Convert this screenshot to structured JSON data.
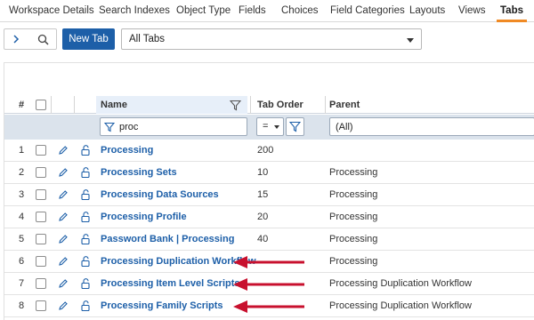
{
  "tabs": [
    {
      "label": "Workspace Details",
      "active": false
    },
    {
      "label": "Search Indexes",
      "active": false
    },
    {
      "label": "Object Type",
      "active": false
    },
    {
      "label": "Fields",
      "active": false
    },
    {
      "label": "Choices",
      "active": false
    },
    {
      "label": "Field Categories",
      "active": false
    },
    {
      "label": "Layouts",
      "active": false
    },
    {
      "label": "Views",
      "active": false
    },
    {
      "label": "Tabs",
      "active": true
    }
  ],
  "toolbar": {
    "new_tab_label": "New Tab",
    "view_select_value": "All Tabs",
    "icons": [
      "chevron-right-icon",
      "search-icon"
    ]
  },
  "grid": {
    "columns": {
      "number": "#",
      "name": "Name",
      "tab_order": "Tab Order",
      "parent": "Parent"
    },
    "filters": {
      "name": "proc",
      "tab_order_operator": "=",
      "parent": "(All)"
    },
    "rows": [
      {
        "number": "1",
        "name": "Processing",
        "tab_order": "200",
        "parent": ""
      },
      {
        "number": "2",
        "name": "Processing Sets",
        "tab_order": "10",
        "parent": "Processing"
      },
      {
        "number": "3",
        "name": "Processing Data Sources",
        "tab_order": "15",
        "parent": "Processing"
      },
      {
        "number": "4",
        "name": "Processing Profile",
        "tab_order": "20",
        "parent": "Processing"
      },
      {
        "number": "5",
        "name": "Password Bank | Processing",
        "tab_order": "40",
        "parent": "Processing"
      },
      {
        "number": "6",
        "name": "Processing Duplication Workflow",
        "tab_order": "",
        "parent": "Processing"
      },
      {
        "number": "7",
        "name": "Processing Item Level Scripts",
        "tab_order": "",
        "parent": "Processing Duplication Workflow"
      },
      {
        "number": "8",
        "name": "Processing Family Scripts",
        "tab_order": "",
        "parent": "Processing Duplication Workflow"
      }
    ]
  },
  "colors": {
    "accent_blue": "#1d5fa8",
    "active_tab_underline": "#f08a24",
    "annotation_arrow": "#c8102e",
    "filter_row_bg": "#dbe3ec"
  }
}
